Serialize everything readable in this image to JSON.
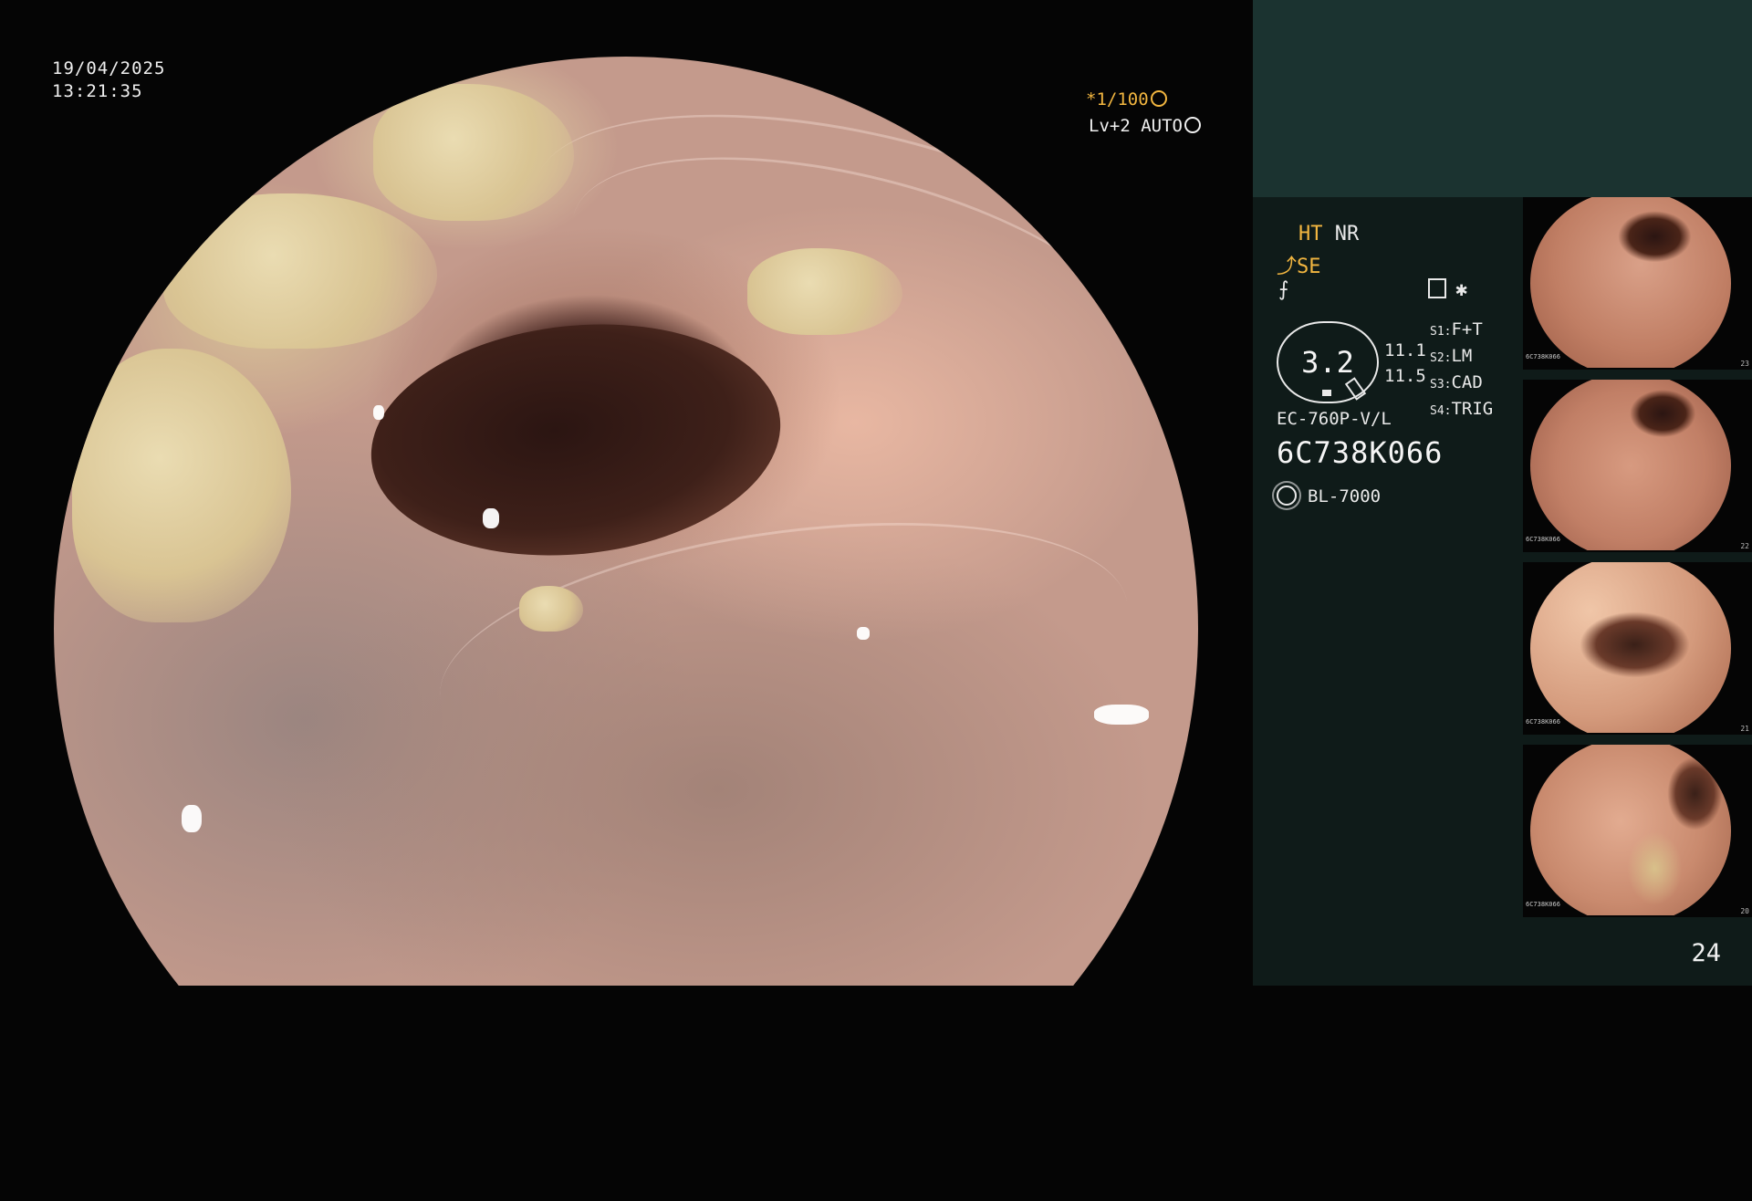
{
  "main": {
    "date": "19/04/2025",
    "time": "13:21:35",
    "shutter": "*1/100",
    "iris": "Lv+2 AUTO"
  },
  "panel": {
    "ht": "HT",
    "nr": "NR",
    "se": "SE",
    "zoom": "3.2",
    "zoom_values": [
      "11.1",
      "11.5"
    ],
    "switches": [
      {
        "key": "S1:",
        "value": "F+T"
      },
      {
        "key": "S2:",
        "value": "LM"
      },
      {
        "key": "S3:",
        "value": "CAD"
      },
      {
        "key": "S4:",
        "value": "TRIG"
      }
    ],
    "scope_model": "EC-760P-V/L",
    "scope_serial": "6C738K066",
    "light_source": "BL-7000",
    "page_number": "24"
  },
  "thumbnails": [
    {
      "serial": "6C738K066",
      "index": "23"
    },
    {
      "serial": "6C738K066",
      "index": "22"
    },
    {
      "serial": "6C738K066",
      "index": "21"
    },
    {
      "serial": "6C738K066",
      "index": "20"
    }
  ],
  "colors": {
    "accent": "#f2b640",
    "panel_top": "#1b3330",
    "panel_bg": "#0f1b19"
  }
}
